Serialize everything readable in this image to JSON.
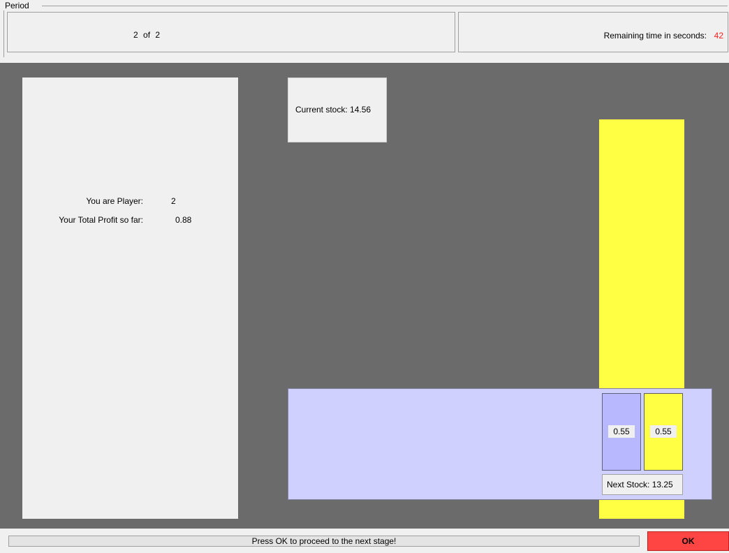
{
  "header": {
    "period_label": "Period",
    "period_current": "2",
    "period_of": "of",
    "period_total": "2",
    "remaining_time_label": "Remaining time in seconds:",
    "remaining_time_value": "42"
  },
  "info": {
    "player_label": "You are Player:",
    "player_value": "2",
    "profit_label": "Your Total Profit so far:",
    "profit_value": "0.88"
  },
  "stock": {
    "current_label": "Current stock:",
    "current_value": "14.56",
    "next_label": "Next Stock:",
    "next_value": "13.25"
  },
  "extraction": {
    "own_value": "0.55",
    "other_value": "0.55"
  },
  "footer": {
    "message": "Press OK to proceed to the next stage!",
    "ok_label": "OK"
  },
  "colors": {
    "background": "#6b6b6b",
    "panel": "#f0f0f0",
    "stock_bar": "#ffff44",
    "decision_panel": "#d0d0ff",
    "own_extraction": "#b8b8ff",
    "ok_button": "#ff4444",
    "time_value": "#ff2020"
  }
}
